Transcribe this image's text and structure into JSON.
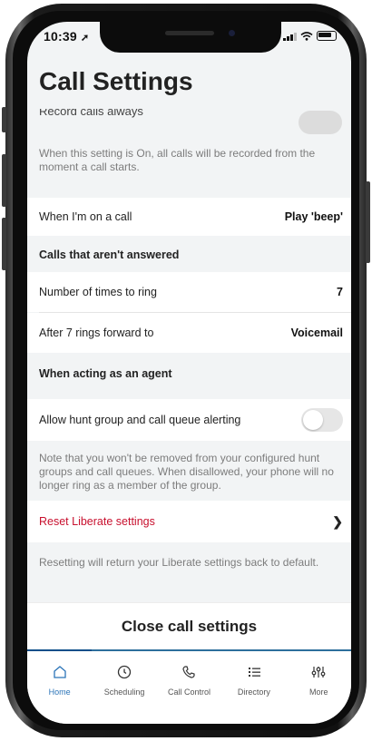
{
  "status_bar": {
    "time": "10:39"
  },
  "header": {
    "title": "Call Settings"
  },
  "record_calls": {
    "label": "Record calls always",
    "note": "When this setting is On, all calls will be recorded from the moment a call starts."
  },
  "on_call": {
    "label": "When I'm on a call",
    "value": "Play 'beep'"
  },
  "unanswered_section": {
    "title": "Calls that aren't answered"
  },
  "ring_count": {
    "label": "Number of times to ring",
    "value": "7"
  },
  "forward": {
    "label": "After 7 rings forward to",
    "value": "Voicemail"
  },
  "agent_section": {
    "title": "When acting as an agent"
  },
  "hunt_group": {
    "label": "Allow hunt group and call queue alerting",
    "enabled": false,
    "note": "Note that you won't be removed from your configured hunt groups and call queues. When disallowed, your phone will no longer ring as a member of the group."
  },
  "reset": {
    "label": "Reset Liberate settings",
    "note": "Resetting will return your Liberate settings back to default."
  },
  "close_button": {
    "label": "Close call settings"
  },
  "tabbar": {
    "items": [
      {
        "label": "Home",
        "icon": "home-icon",
        "active": true
      },
      {
        "label": "Scheduling",
        "icon": "clock-icon",
        "active": false
      },
      {
        "label": "Call Control",
        "icon": "phone-icon",
        "active": false
      },
      {
        "label": "Directory",
        "icon": "list-icon",
        "active": false
      },
      {
        "label": "More",
        "icon": "sliders-icon",
        "active": false
      }
    ]
  },
  "colors": {
    "accent": "#2b74b8",
    "danger": "#c8102e",
    "background": "#f2f4f5"
  }
}
